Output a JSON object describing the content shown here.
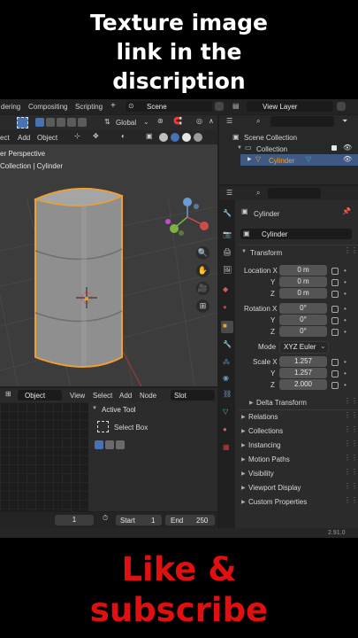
{
  "caption_top": [
    "Texture image",
    "link in the",
    "discription"
  ],
  "caption_bottom": [
    "Like &",
    "subscribe"
  ],
  "topbar": {
    "tabs": [
      "dering",
      "Compositing",
      "Scripting"
    ],
    "plus": "+",
    "scene_label": "Scene",
    "view_layer_label": "View Layer"
  },
  "viewport_header": {
    "menu": [
      "ect",
      "Add",
      "Object"
    ],
    "orientation": "Global"
  },
  "viewport": {
    "perspective": "er Perspective",
    "collection": "Collection | Cylinder"
  },
  "outliner": {
    "search_placeholder": "",
    "items": [
      {
        "label": "Scene Collection"
      },
      {
        "label": "Collection"
      },
      {
        "label": "Cylinder"
      }
    ]
  },
  "properties": {
    "object_name": "Cylinder",
    "datablock_name": "Cylinder",
    "transform_title": "Transform",
    "location": {
      "label_x": "Location X",
      "y_label": "Y",
      "z_label": "Z",
      "x": "0 m",
      "y": "0 m",
      "z": "0 m"
    },
    "rotation": {
      "label_x": "Rotation X",
      "y_label": "Y",
      "z_label": "Z",
      "x": "0°",
      "y": "0°",
      "z": "0°"
    },
    "mode": {
      "label": "Mode",
      "value": "XYZ Euler"
    },
    "scale": {
      "label_x": "Scale X",
      "y_label": "Y",
      "z_label": "Z",
      "x": "1.257",
      "y": "1.257",
      "z": "2.000"
    },
    "delta_transform": "Delta Transform",
    "sections": [
      "Relations",
      "Collections",
      "Instancing",
      "Motion Paths",
      "Visibility",
      "Viewport Display",
      "Custom Properties"
    ]
  },
  "editor2": {
    "header": [
      "Object",
      "View",
      "Select",
      "Add",
      "Node",
      "Slot"
    ],
    "active_tool_title": "Active Tool",
    "active_tool_name": "Select Box"
  },
  "timeline": {
    "frame": "1",
    "start_label": "Start",
    "start": "1",
    "end_label": "End",
    "end": "250"
  },
  "version": "2.91.0",
  "colors": {
    "accent": "#4772b3",
    "selection": "#f0a030",
    "text_red": "#e01010"
  }
}
